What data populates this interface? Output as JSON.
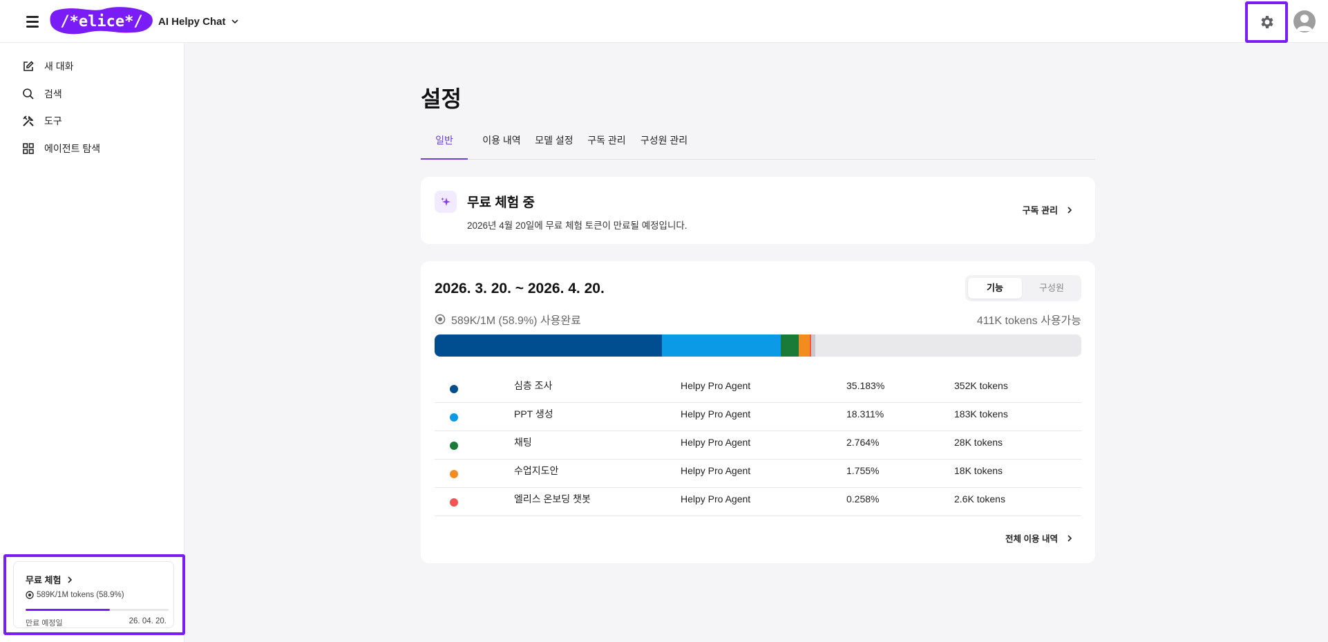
{
  "topbar": {
    "logo_text": "/*elice*/",
    "app_name": "AI Helpy Chat",
    "icons": [
      "hamburger-menu-icon",
      "chevron-down-icon",
      "gear-icon",
      "avatar-icon"
    ]
  },
  "sidebar": {
    "items": [
      {
        "label": "새 대화",
        "icon": "edit-icon"
      },
      {
        "label": "검색",
        "icon": "search-icon"
      },
      {
        "label": "도구",
        "icon": "tools-icon"
      },
      {
        "label": "에이전트 탐색",
        "icon": "grid-icon"
      }
    ],
    "trial": {
      "title": "무료 체험",
      "usage": "589K/1M tokens (58.9%)",
      "progress_percent": 58.9,
      "expiry_label": "만료 예정일",
      "expiry_date": "26. 04. 20."
    }
  },
  "main": {
    "title": "설정",
    "tabs": [
      {
        "label": "일반",
        "active": true
      },
      {
        "label": "이용 내역",
        "active": false
      },
      {
        "label": "모델 설정",
        "active": false
      },
      {
        "label": "구독 관리",
        "active": false
      },
      {
        "label": "구성원 관리",
        "active": false
      }
    ],
    "trial_card": {
      "title": "무료 체험 중",
      "description": "2026년 4월 20일에 무료 체험 토큰이 만료될 예정입니다.",
      "link": "구독 관리"
    },
    "usage_card": {
      "period": "2026. 3. 20. ~ 2026. 4. 20.",
      "toggle": [
        {
          "label": "기능",
          "active": true
        },
        {
          "label": "구성원",
          "active": false
        }
      ],
      "used": "589K/1M (58.9%) 사용완료",
      "available": "411K tokens 사용가능",
      "rows": [
        {
          "name": "심층 조사",
          "agent": "Helpy Pro Agent",
          "percent": "35.183%",
          "tokens": "352K tokens",
          "color": "#004d8f",
          "share": 35.183
        },
        {
          "name": "PPT 생성",
          "agent": "Helpy Pro Agent",
          "percent": "18.311%",
          "tokens": "183K tokens",
          "color": "#0a9ae6",
          "share": 18.311
        },
        {
          "name": "채팅",
          "agent": "Helpy Pro Agent",
          "percent": "2.764%",
          "tokens": "28K tokens",
          "color": "#1a7a37",
          "share": 2.764
        },
        {
          "name": "수업지도안",
          "agent": "Helpy Pro Agent",
          "percent": "1.755%",
          "tokens": "18K tokens",
          "color": "#f28c1e",
          "share": 1.755
        },
        {
          "name": "엘리스 온보딩 챗봇",
          "agent": "Helpy Pro Agent",
          "percent": "0.258%",
          "tokens": "2.6K tokens",
          "color": "#f05454",
          "share": 0.258
        }
      ],
      "remaining_color": "#c9c9cd",
      "remaining_share": 0.63,
      "all_link": "전체 이용 내역"
    }
  }
}
